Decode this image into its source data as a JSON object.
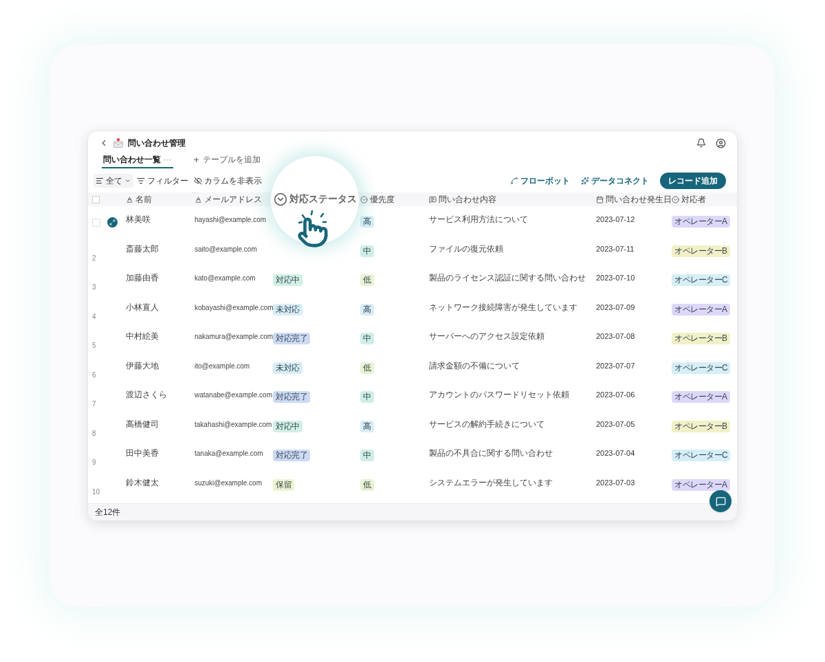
{
  "header": {
    "title": "問い合わせ管理"
  },
  "tabs": [
    {
      "label": "問い合わせ一覧",
      "selected": true,
      "more": "···"
    },
    {
      "label": "テーブルを追加",
      "selected": false,
      "add": true
    }
  ],
  "toolbar": {
    "left": [
      {
        "label": "全て",
        "kind": "view"
      },
      {
        "label": "フィルター",
        "kind": "filter"
      },
      {
        "label": "カラムを非表示",
        "kind": "hide"
      }
    ],
    "right": [
      {
        "label": "フローボット",
        "kind": "flow"
      },
      {
        "label": "データコネクト",
        "kind": "connect"
      }
    ],
    "primary": "レコード追加"
  },
  "columns": [
    {
      "label": "名前",
      "kind": "text"
    },
    {
      "label": "メールアドレス",
      "kind": "text"
    },
    {
      "label": "対応ステータス",
      "kind": "select",
      "magnified": true
    },
    {
      "label": "優先度",
      "kind": "select"
    },
    {
      "label": "問い合わせ内容",
      "kind": "longtext"
    },
    {
      "label": "問い合わせ発生日",
      "kind": "date"
    },
    {
      "label": "対応者",
      "kind": "select"
    }
  ],
  "rows": [
    {
      "hovered": true,
      "name": "林美咲",
      "email": "hayashi@example.com",
      "priority": {
        "label": "高",
        "color": "#d7eef8"
      },
      "content": "サービス利用方法について",
      "date": "2023-07-12",
      "assignee": {
        "label": "オペレーターA",
        "color": "#ddd7fa"
      }
    },
    {
      "hovered": false,
      "number": "2",
      "name": "斎藤太郎",
      "email": "saito@example.com",
      "priority": {
        "label": "中",
        "color": "#cfeee6"
      },
      "content": "ファイルの復元依頼",
      "date": "2023-07-11",
      "assignee": {
        "label": "オペレーターB",
        "color": "#f2f0c6"
      }
    },
    {
      "hovered": false,
      "number": "3",
      "name": "加藤由香",
      "email": "kato@example.com",
      "status": {
        "label": "対応中",
        "color": "#d2f0e5"
      },
      "priority": {
        "label": "低",
        "color": "#e9f2d2"
      },
      "content": "製品のライセンス認証に関する問い合わせ",
      "date": "2023-07-10",
      "assignee": {
        "label": "オペレーターC",
        "color": "#d5eef8"
      }
    },
    {
      "hovered": false,
      "number": "4",
      "name": "小林直人",
      "email": "kobayashi@example.com",
      "status": {
        "label": "未対応",
        "color": "#d7eef8"
      },
      "priority": {
        "label": "高",
        "color": "#d7eef8"
      },
      "content": "ネットワーク接続障害が発生しています",
      "date": "2023-07-09",
      "assignee": {
        "label": "オペレーターA",
        "color": "#ddd7fa"
      }
    },
    {
      "hovered": false,
      "number": "5",
      "name": "中村絵美",
      "email": "nakamura@example.com",
      "status": {
        "label": "対応完了",
        "color": "#ccdaf5"
      },
      "priority": {
        "label": "中",
        "color": "#cfeee6"
      },
      "content": "サーバーへのアクセス設定依頼",
      "date": "2023-07-08",
      "assignee": {
        "label": "オペレーターB",
        "color": "#f2f0c6"
      }
    },
    {
      "hovered": false,
      "number": "6",
      "name": "伊藤大地",
      "email": "ito@example.com",
      "status": {
        "label": "未対応",
        "color": "#d7eef8"
      },
      "priority": {
        "label": "低",
        "color": "#e9f2d2"
      },
      "content": "請求金額の不備について",
      "date": "2023-07-07",
      "assignee": {
        "label": "オペレーターC",
        "color": "#d5eef8"
      }
    },
    {
      "hovered": false,
      "number": "7",
      "name": "渡辺さくら",
      "email": "watanabe@example.com",
      "status": {
        "label": "対応完了",
        "color": "#ccdaf5"
      },
      "priority": {
        "label": "中",
        "color": "#cfeee6"
      },
      "content": "アカウントのパスワードリセット依頼",
      "date": "2023-07-06",
      "assignee": {
        "label": "オペレーターA",
        "color": "#ddd7fa"
      }
    },
    {
      "hovered": false,
      "number": "8",
      "name": "高橋健司",
      "email": "takahashi@example.com",
      "status": {
        "label": "対応中",
        "color": "#d2f0e5"
      },
      "priority": {
        "label": "高",
        "color": "#d7eef8"
      },
      "content": "サービスの解約手続きについて",
      "date": "2023-07-05",
      "assignee": {
        "label": "オペレーターB",
        "color": "#f2f0c6"
      }
    },
    {
      "hovered": false,
      "number": "9",
      "name": "田中美香",
      "email": "tanaka@example.com",
      "status": {
        "label": "対応完了",
        "color": "#ccdaf5"
      },
      "priority": {
        "label": "中",
        "color": "#cfeee6"
      },
      "content": "製品の不具合に関する問い合わせ",
      "date": "2023-07-04",
      "assignee": {
        "label": "オペレーターC",
        "color": "#d5eef8"
      }
    },
    {
      "hovered": false,
      "number": "10",
      "name": "鈴木健太",
      "email": "suzuki@example.com",
      "status": {
        "label": "保留",
        "color": "#eef3d0"
      },
      "priority": {
        "label": "低",
        "color": "#e9f2d2"
      },
      "content": "システムエラーが発生しています",
      "date": "2023-07-03",
      "assignee": {
        "label": "オペレーターA",
        "color": "#ddd7fa"
      }
    }
  ],
  "footer": {
    "count": "全12件"
  },
  "select_all_checked": false
}
